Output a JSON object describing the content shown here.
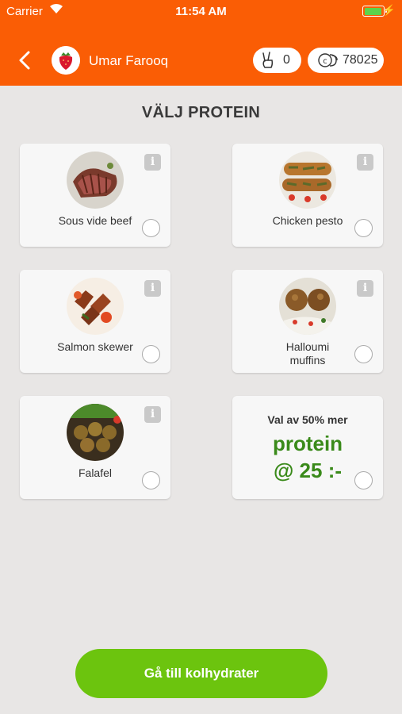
{
  "status_bar": {
    "carrier": "Carrier",
    "time": "11:54 AM"
  },
  "header": {
    "user_name": "Umar Farooq",
    "peace_count": "0",
    "coins_count": "78025",
    "accent": "#fa5d05"
  },
  "page": {
    "title": "VÄLJ PROTEIN"
  },
  "items": [
    {
      "label": "Sous vide beef",
      "icon": "beef-photo"
    },
    {
      "label": "Chicken pesto",
      "icon": "chicken-photo"
    },
    {
      "label": "Salmon skewer",
      "icon": "salmon-photo"
    },
    {
      "label_line1": "Halloumi",
      "label_line2": "muffins",
      "icon": "halloumi-photo"
    },
    {
      "label": "Falafel",
      "icon": "falafel-photo"
    }
  ],
  "promo": {
    "line1": "Val av 50% mer",
    "line2": "protein",
    "line3": "@ 25 :-"
  },
  "cta": {
    "label": "Gå till kolhydrater",
    "color": "#6cc40e"
  }
}
